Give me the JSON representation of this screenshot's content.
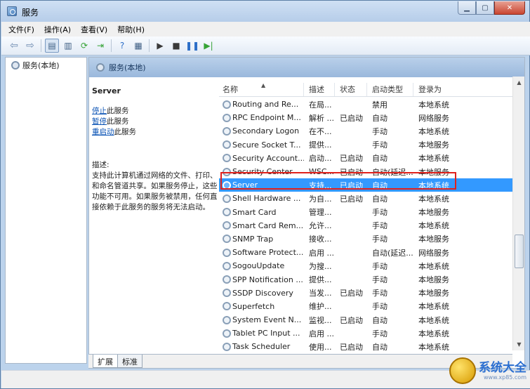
{
  "window": {
    "title": "服务"
  },
  "menu": [
    "文件(F)",
    "操作(A)",
    "查看(V)",
    "帮助(H)"
  ],
  "toolbar": {
    "icons": [
      "back-arrow-icon",
      "forward-arrow-icon",
      "console-tree-icon",
      "properties-icon",
      "refresh-icon",
      "export-icon",
      "help-icon",
      "view-icon",
      "start-icon",
      "stop-icon",
      "pause-icon",
      "restart-icon"
    ]
  },
  "tree": {
    "root_label": "服务(本地)"
  },
  "pane": {
    "header": "服务(本地)",
    "selected_service": "Server",
    "actions": [
      {
        "link": "停止",
        "rest": "此服务"
      },
      {
        "link": "暂停",
        "rest": "此服务"
      },
      {
        "link": "重启动",
        "rest": "此服务"
      }
    ],
    "description_label": "描述:",
    "description": "支持此计算机通过网络的文件、打印、和命名管道共享。如果服务停止，这些功能不可用。如果服务被禁用，任何直接依赖于此服务的服务将无法启动。"
  },
  "columns": [
    "名称",
    "描述",
    "状态",
    "启动类型",
    "登录为"
  ],
  "rows": [
    [
      "Routing and Re...",
      "在局...",
      "",
      "禁用",
      "本地系统"
    ],
    [
      "RPC Endpoint M...",
      "解析 ...",
      "已启动",
      "自动",
      "网络服务"
    ],
    [
      "Secondary Logon",
      "在不...",
      "",
      "手动",
      "本地系统"
    ],
    [
      "Secure Socket T...",
      "提供...",
      "",
      "手动",
      "本地服务"
    ],
    [
      "Security Account...",
      "启动...",
      "已启动",
      "自动",
      "本地系统"
    ],
    [
      "Security Center",
      "WSC...",
      "已启动",
      "自动(延迟...",
      "本地服务"
    ],
    [
      "Server",
      "支持...",
      "已启动",
      "自动",
      "本地系统"
    ],
    [
      "Shell Hardware ...",
      "为自...",
      "已启动",
      "自动",
      "本地系统"
    ],
    [
      "Smart Card",
      "管理...",
      "",
      "手动",
      "本地服务"
    ],
    [
      "Smart Card Rem...",
      "允许...",
      "",
      "手动",
      "本地系统"
    ],
    [
      "SNMP Trap",
      "接收...",
      "",
      "手动",
      "本地服务"
    ],
    [
      "Software Protect...",
      "启用 ...",
      "",
      "自动(延迟...",
      "网络服务"
    ],
    [
      "SogouUpdate",
      "为搜...",
      "",
      "手动",
      "本地系统"
    ],
    [
      "SPP Notification ...",
      "提供...",
      "",
      "手动",
      "本地服务"
    ],
    [
      "SSDP Discovery",
      "当发...",
      "已启动",
      "手动",
      "本地服务"
    ],
    [
      "Superfetch",
      "维护...",
      "",
      "手动",
      "本地系统"
    ],
    [
      "System Event N...",
      "监视...",
      "已启动",
      "自动",
      "本地系统"
    ],
    [
      "Tablet PC Input ...",
      "启用 ...",
      "",
      "手动",
      "本地系统"
    ],
    [
      "Task Scheduler",
      "使用...",
      "已启动",
      "自动",
      "本地系统"
    ]
  ],
  "selected_row": 6,
  "tabs": [
    "扩展",
    "标准"
  ],
  "watermark": {
    "text": "系统大全",
    "sub": "www.xp85.com"
  },
  "colors": {
    "selection": "#3399ff",
    "highlight_outline": "#e0211d",
    "link": "#0a53b5"
  }
}
